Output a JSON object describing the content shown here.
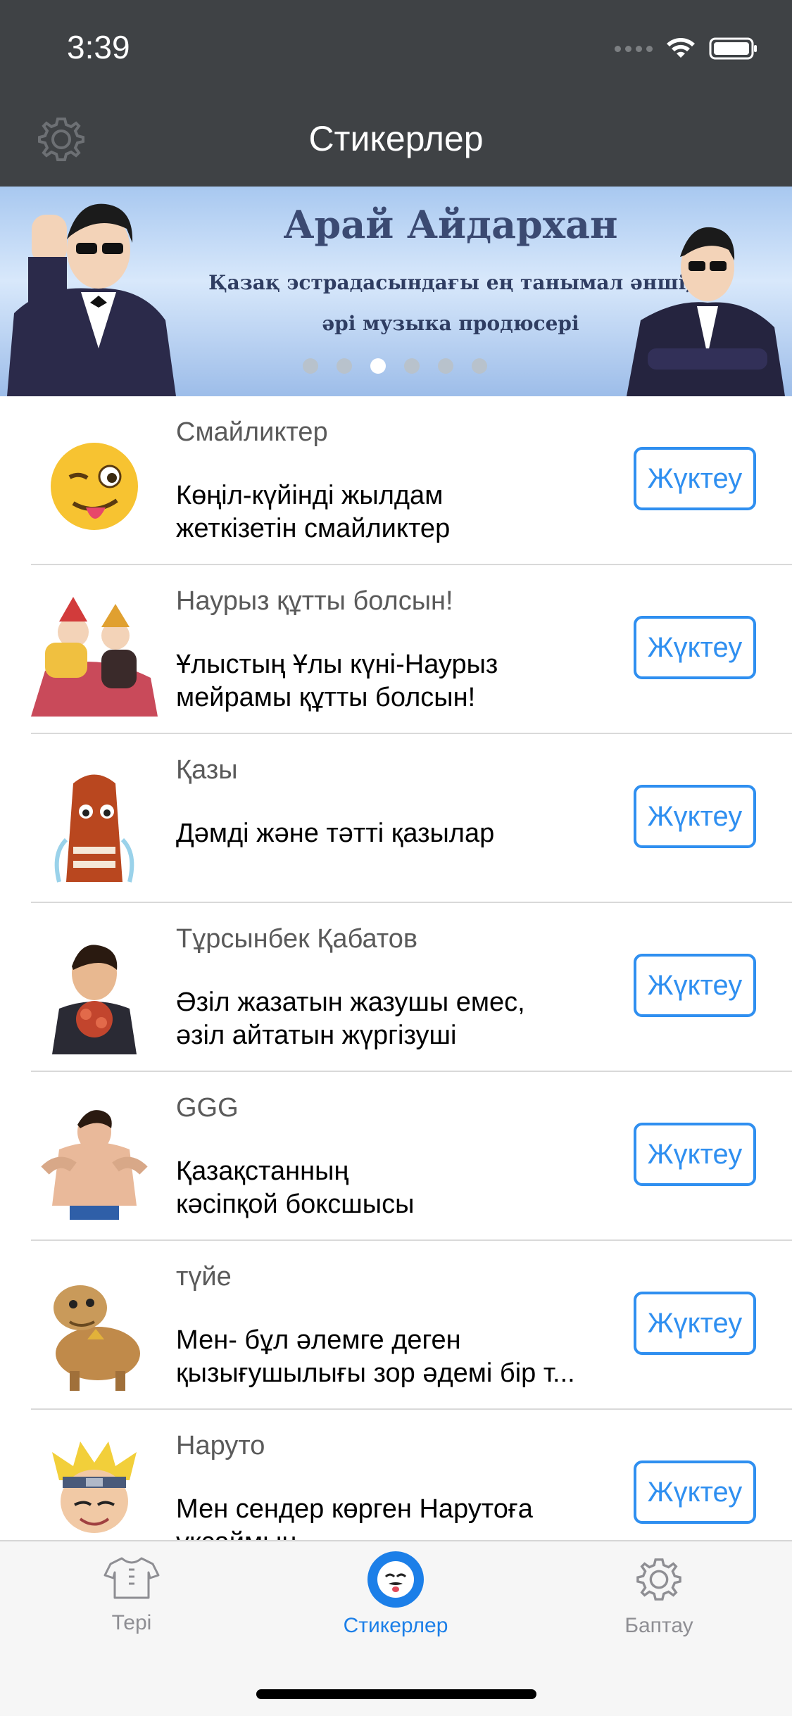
{
  "status_bar": {
    "time": "3:39"
  },
  "header": {
    "title": "Стикерлер"
  },
  "banner": {
    "title": "Арай Айдархан",
    "subtitle_line1": "Қазақ эстрадасындағы ең танымал әнші,",
    "subtitle_line2": "әрі музыка продюсері",
    "page_count": 6,
    "active_page": 3
  },
  "items": [
    {
      "name": "Смайликтер",
      "desc": "Көңіл-күйінді жылдам\nжеткізетін смайликтер",
      "button": "Жүктеу",
      "icon": "winking-emoji-icon"
    },
    {
      "name": "Наурыз құтты болсын!",
      "desc": "Ұлыстың Ұлы күні-Наурыз\nмейрамы құтты болсын!",
      "button": "Жүктеу",
      "icon": "nauryz-dancers-icon"
    },
    {
      "name": "Қазы",
      "desc": "Дәмді және тәтті қазылар",
      "button": "Жүктеу",
      "icon": "qazy-sausage-icon"
    },
    {
      "name": "Тұрсынбек Қабатов",
      "desc": "Әзіл жазатын жазушы емес,\nәзіл айтатын жүргізуші",
      "button": "Жүктеу",
      "icon": "man-with-bouquet-icon"
    },
    {
      "name": "GGG",
      "desc": "Қазақстанның\nкәсіпқой боксшысы",
      "button": "Жүктеу",
      "icon": "boxer-icon"
    },
    {
      "name": "түйе",
      "desc": "Мен- бұл әлемге деген\nқызығушылығы зор әдемі бір т...",
      "button": "Жүктеу",
      "icon": "camel-icon"
    },
    {
      "name": "Наруто",
      "desc": "Мен сендер көрген Нарутоға\nұқсаймын",
      "button": "Жүктеу",
      "icon": "naruto-icon"
    }
  ],
  "tabbar": {
    "tabs": [
      {
        "label": "Тері",
        "icon": "tshirt-icon",
        "active": false
      },
      {
        "label": "Стикерлер",
        "icon": "sticker-face-icon",
        "active": true
      },
      {
        "label": "Баптау",
        "icon": "gear-icon",
        "active": false
      }
    ]
  },
  "colors": {
    "header_bg": "#3f4245",
    "accent": "#2f8ff0",
    "inactive": "#8e8e93"
  }
}
